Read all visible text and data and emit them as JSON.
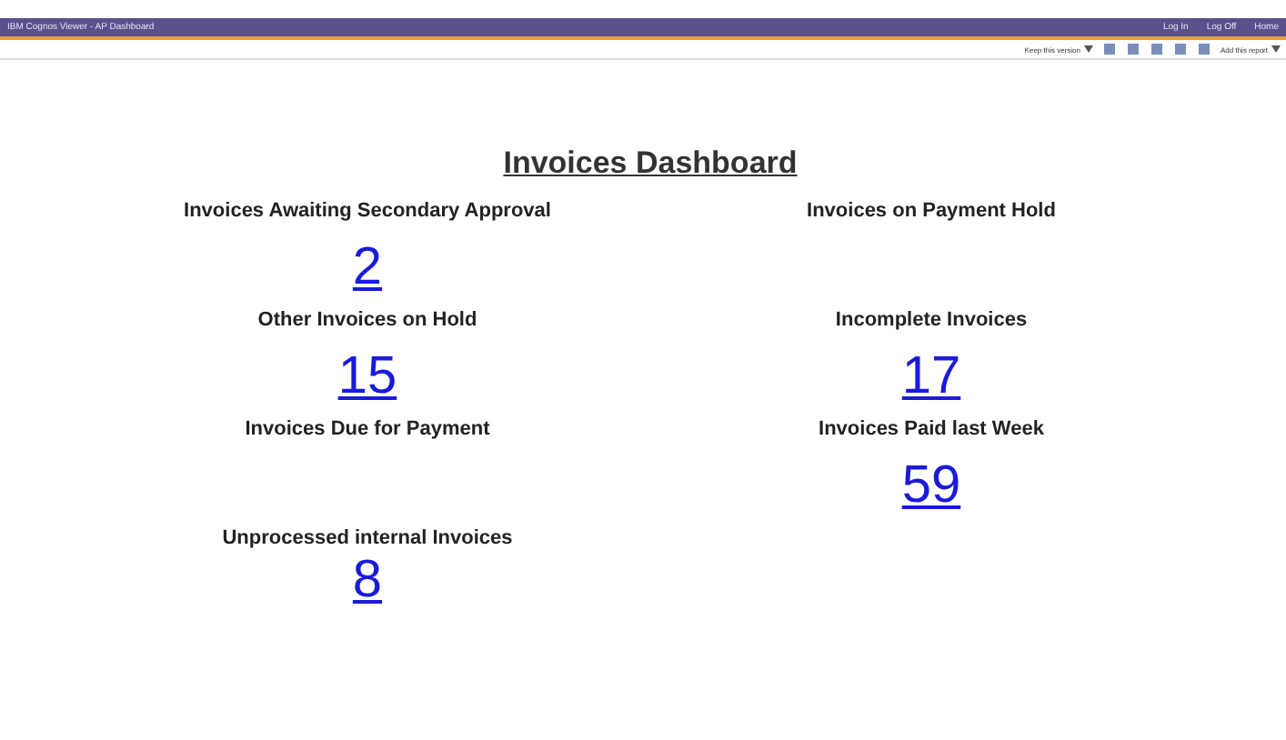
{
  "window": {
    "title": "IBM Cognos Viewer - AP Dashboard",
    "links": [
      "Log In",
      "Log Off",
      "Home"
    ]
  },
  "toolbar": {
    "items": [
      {
        "kind": "menu",
        "label": "Keep this version"
      },
      {
        "kind": "icon"
      },
      {
        "kind": "icon"
      },
      {
        "kind": "icon"
      },
      {
        "kind": "icon"
      },
      {
        "kind": "icon"
      },
      {
        "kind": "menu",
        "label": "Add this report"
      }
    ]
  },
  "report": {
    "title": "Invoices Dashboard",
    "tiles": [
      {
        "title": "Invoices Awaiting Secondary Approval",
        "count": "2"
      },
      {
        "title": "Invoices on Payment Hold"
      },
      {
        "title": "Other Invoices on Hold",
        "count": "15"
      },
      {
        "title": "Incomplete Invoices",
        "count": "17"
      },
      {
        "title": "Invoices Due for Payment"
      },
      {
        "title": "Invoices Paid last Week",
        "count": "59"
      },
      {
        "title": "Unprocessed internal Invoices",
        "count": "8"
      }
    ]
  }
}
